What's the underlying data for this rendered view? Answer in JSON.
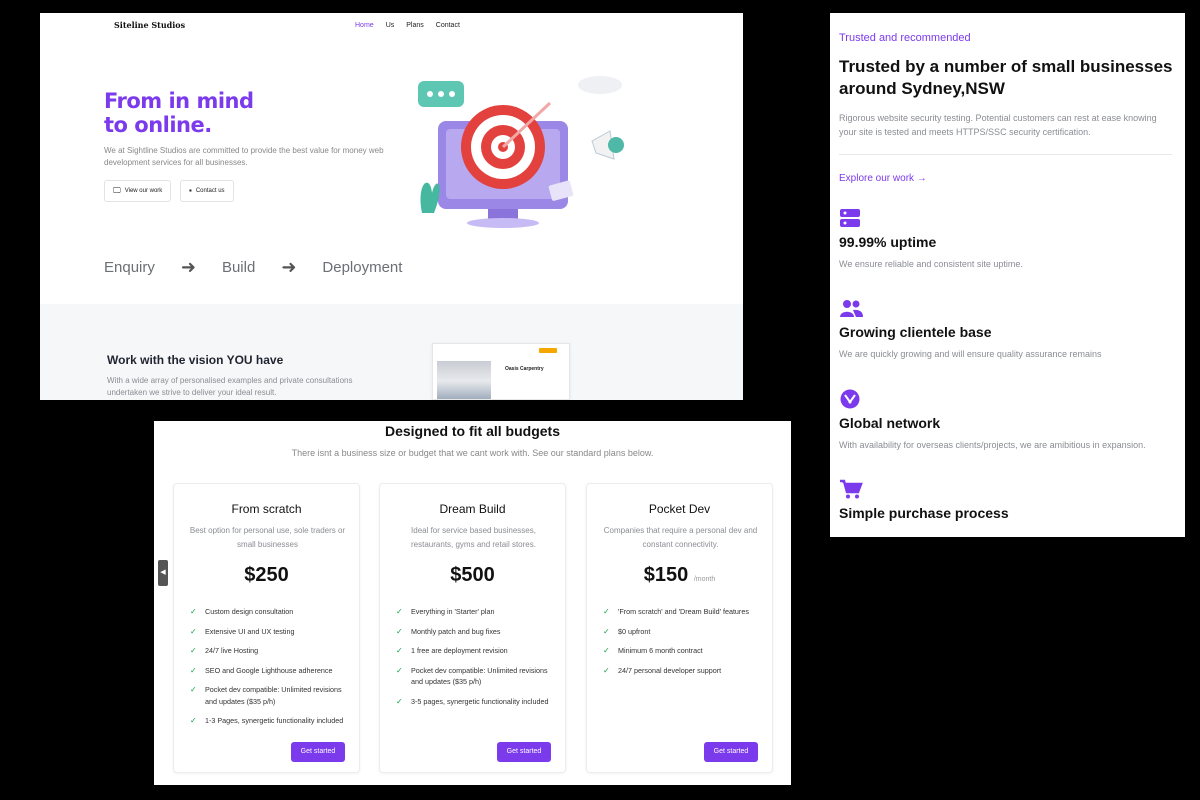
{
  "hero": {
    "logo": "Siteline Studios",
    "nav": [
      "Home",
      "Us",
      "Plans",
      "Contact"
    ],
    "title_line1": "From in mind",
    "title_line2": "to online.",
    "description": "We at Sightline Studios are committed to provide the best value for money web development services for all businesses.",
    "btn_work": "View our work",
    "btn_contact": "Contact us",
    "steps": [
      "Enquiry",
      "Build",
      "Deployment"
    ],
    "vision_title": "Work with the vision YOU have",
    "vision_desc": "With a wide array of personalised examples and private consultations undertaken we strive to deliver your ideal result.",
    "preview_title": "Oasis Carpentry",
    "colors": {
      "accent": "#7c3aed"
    }
  },
  "features": {
    "eyebrow": "Trusted and recommended",
    "title": "Trusted by a number of small businesses around Sydney,NSW",
    "description": "Rigorous website security testing. Potential customers can rest at ease knowing your site is tested and meets HTTPS/SSC security certification.",
    "explore": "Explore our work →",
    "items": [
      {
        "icon": "server-icon",
        "title": "99.99% uptime",
        "desc": "We ensure reliable and consistent site uptime."
      },
      {
        "icon": "users-icon",
        "title": "Growing clientele base",
        "desc": "We are quickly growing and will ensure quality assurance remains"
      },
      {
        "icon": "globe-icon",
        "title": "Global network",
        "desc": "With availability for overseas clients/projects, we are amibitious in expansion."
      },
      {
        "icon": "cart-icon",
        "title": "Simple purchase process",
        "desc": ""
      }
    ]
  },
  "pricing": {
    "title": "Designed to fit all budgets",
    "subtitle": "There isnt a business size or budget that we cant work with. See our standard plans below.",
    "plans": [
      {
        "name": "From scratch",
        "desc": "Best option for personal use, sole traders or small businesses",
        "price": "$250",
        "per": "",
        "features": [
          "Custom design consultation",
          "Extensive UI and UX testing",
          "24/7 live Hosting",
          "SEO and Google Lighthouse adherence",
          "Pocket dev compatible: Unlimited revisions and updates ($35 p/h)",
          "1-3 Pages, synergetic functionality included"
        ],
        "cta": "Get started"
      },
      {
        "name": "Dream Build",
        "desc": "Ideal for service based businesses, restaurants, gyms and retail stores.",
        "price": "$500",
        "per": "",
        "features": [
          "Everything in 'Starter' plan",
          "Monthly patch and bug fixes",
          "1 free are deployment revision",
          "Pocket dev compatible: Unlimited revisions and updates ($35 p/h)",
          "3-5 pages, synergetic functionality included"
        ],
        "cta": "Get started"
      },
      {
        "name": "Pocket Dev",
        "desc": "Companies that require a personal dev and constant connectivity.",
        "price": "$150",
        "per": "/month",
        "features": [
          "'From scratch' and 'Dream Build' features",
          "$0 upfront",
          "Minimum 6 month contract",
          "24/7 personal developer support"
        ],
        "cta": "Get started"
      }
    ],
    "check_color": "#16a34a"
  }
}
